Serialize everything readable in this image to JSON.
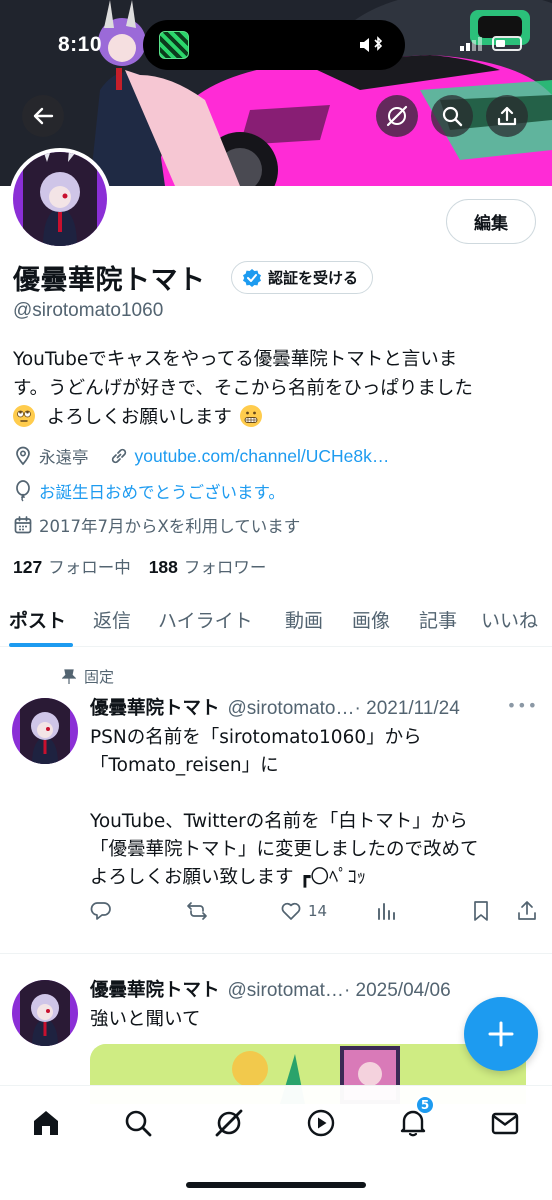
{
  "status_bar": {
    "time": "8:10"
  },
  "profile": {
    "display_name": "優曇華院トマト",
    "verify_label": "認証を受ける",
    "handle": "@sirotomato1060",
    "edit_label": "編集",
    "bio_line1": "YouTubeでキャスをやってる優曇華院トマトと言いま",
    "bio_line2": "す。うどんげが好きで、そこから名前をひっぱりました",
    "bio_line3": "よろしくお願いします",
    "location": "永遠亭",
    "website": "youtube.com/channel/UCHe8k…",
    "birthday": "お誕生日おめでとうございます。",
    "joined": "2017年7月からXを利用しています",
    "following_count": "127",
    "following_label": "フォロー中",
    "followers_count": "188",
    "followers_label": "フォロワー"
  },
  "tabs": [
    "ポスト",
    "返信",
    "ハイライト",
    "動画",
    "画像",
    "記事",
    "いいね"
  ],
  "posts": [
    {
      "pinned_label": "固定",
      "name": "優曇華院トマト",
      "handle": "@sirotomato…",
      "date": "· 2021/11/24",
      "text": "PSNの名前を「sirotomato1060」から\n「Tomato_reisen」に\n\nYouTube、Twitterの名前を「白トマト」から\n「優曇華院トマト」に変更しましたので改めて\nよろしくお願い致します ┏〇ﾍﾟｺｯ",
      "likes": "14"
    },
    {
      "name": "優曇華院トマト",
      "handle": "@sirotomat…",
      "date": "· 2025/04/06",
      "text": "強いと聞いて"
    }
  ],
  "notifications_badge": "5",
  "colors": {
    "accent": "#1d9bf0",
    "secondary_text": "#536471",
    "banner_car": "#ff2bd6"
  }
}
